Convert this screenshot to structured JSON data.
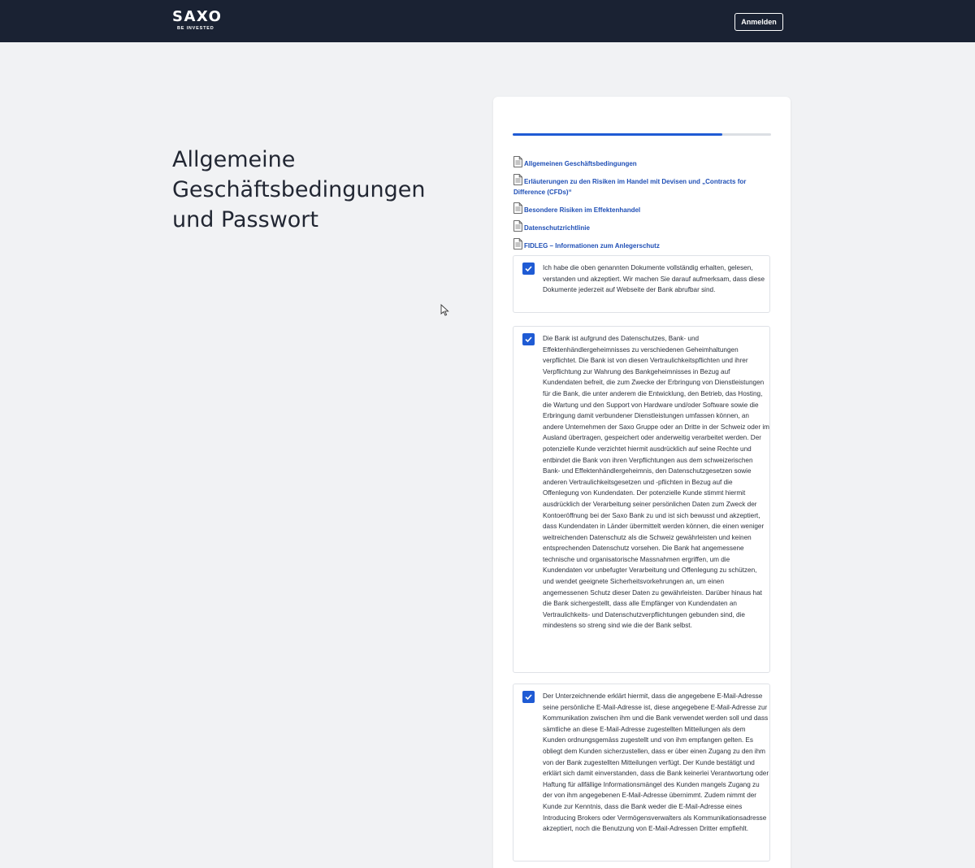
{
  "header": {
    "logo_main": "SAXO",
    "logo_sub": "BE INVESTED",
    "login_label": "Anmelden"
  },
  "page": {
    "title": "Allgemeine Geschäftsbedingungen und Passwort"
  },
  "progress": {
    "value_fraction": 0.81
  },
  "documents": [
    {
      "label": "Allgemeinen Geschäftsbedingungen",
      "icon": "document-icon"
    },
    {
      "label": "Erläuterungen zu den Risiken im Handel mit Devisen und „Contracts for Difference (CFDs)“",
      "icon": "document-icon"
    },
    {
      "label": "Besondere Risiken im Effektenhandel",
      "icon": "document-icon"
    },
    {
      "label": "Datenschutzrichtlinie",
      "icon": "document-icon"
    },
    {
      "label": "FIDLEG – Informationen zum Anlegerschutz",
      "icon": "document-icon"
    }
  ],
  "consents": [
    {
      "checked": true,
      "text": "Ich habe die oben genannten Dokumente vollständig erhalten, gelesen, verstanden und akzeptiert. Wir machen Sie darauf aufmerksam, dass diese Dokumente jederzeit auf Webseite der Bank abrufbar sind."
    },
    {
      "checked": true,
      "text": "Die Bank ist aufgrund des Datenschutzes, Bank- und Effektenhändlergeheimnisses zu verschiedenen Geheimhaltungen verpflichtet. Die Bank ist von diesen Vertraulichkeitspflichten und ihrer Verpflichtung zur Wahrung des Bankgeheimnisses in Bezug auf Kundendaten befreit, die zum Zwecke der Erbringung von Dienstleistungen für die Bank, die unter anderem die Entwicklung, den Betrieb, das Hosting, die Wartung und den Support von Hardware und/oder Software sowie die Erbringung damit verbundener Dienstleistungen umfassen können, an andere Unternehmen der Saxo Gruppe oder an Dritte in der Schweiz oder im Ausland übertragen, gespeichert oder anderweitig verarbeitet werden. Der potenzielle Kunde verzichtet hiermit ausdrücklich auf seine Rechte und entbindet die Bank von ihren Verpflichtungen aus dem schweizerischen Bank- und Effektenhändlergeheimnis, den Datenschutzgesetzen sowie anderen Vertraulichkeitsgesetzen und -pflichten in Bezug auf die Offenlegung von Kundendaten. Der potenzielle Kunde stimmt hiermit ausdrücklich der Verarbeitung seiner persönlichen Daten zum Zweck der Kontoeröffnung bei der Saxo Bank zu und ist sich bewusst und akzeptiert, dass Kundendaten in Länder übermittelt werden können, die einen weniger weitreichenden Datenschutz als die Schweiz gewährleisten und keinen entsprechenden Datenschutz vorsehen. Die Bank hat angemessene technische und organisatorische Massnahmen ergriffen, um die Kundendaten vor unbefugter Verarbeitung und Offenlegung zu schützen, und wendet geeignete Sicherheitsvorkehrungen an, um einen angemessenen Schutz dieser Daten zu gewährleisten. Darüber hinaus hat die Bank sichergestellt, dass alle Empfänger von Kundendaten an Vertraulichkeits- und Datenschutzverpflichtungen gebunden sind, die mindestens so streng sind wie die der Bank selbst."
    },
    {
      "checked": true,
      "text": "Der Unterzeichnende erklärt hiermit, dass die angegebene E-Mail-Adresse seine persönliche E-Mail-Adresse ist, diese angegebene E-Mail-Adresse zur Kommunikation zwischen ihm und die Bank verwendet werden soll und dass sämtliche an diese E-Mail-Adresse zugestellten Mitteilungen als dem Kunden ordnungsgemäss zugestellt und von ihm empfangen gelten. Es obliegt dem Kunden sicherzustellen, dass er über einen Zugang zu den ihm von der Bank zugestellten Mitteilungen verfügt. Der Kunde bestätigt und erklärt sich damit einverstanden, dass die Bank keinerlei Verantwortung oder Haftung für allfällige Informationsmängel des Kunden mangels Zugang zu der von ihm angegebenen E-Mail-Adresse übernimmt. Zudem nimmt der Kunde zur Kenntnis, dass die Bank weder die E-Mail-Adresse eines Introducing Brokers oder Vermögensverwalters als Kommunikationsadresse akzeptiert, noch die Benutzung von E-Mail-Adressen Dritter empfiehlt."
    }
  ],
  "colors": {
    "header_bg": "#1a2233",
    "accent": "#1f5bd4",
    "link": "#1f4fb6",
    "page_bg": "#f1f2f4"
  }
}
